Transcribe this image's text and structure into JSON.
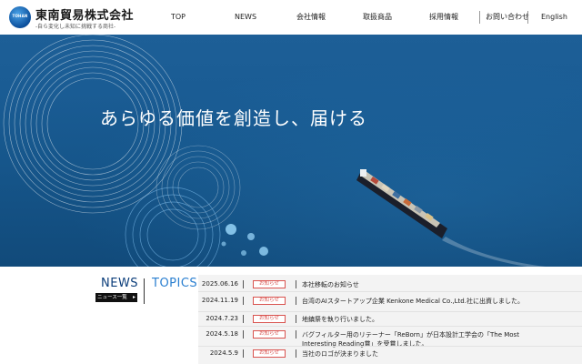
{
  "header": {
    "logo_text": "TOHAN",
    "company_name": "東南貿易株式会社",
    "tagline": "-自ら変化し未知に挑戦する商社-"
  },
  "nav": {
    "items": [
      "TOP",
      "NEWS",
      "会社情報",
      "取扱商品",
      "採用情報"
    ],
    "contact": "お問い合わせ",
    "language": "English"
  },
  "hero": {
    "headline": "あらゆる価値を創造し、届ける"
  },
  "news_section": {
    "news_title": "NEWS",
    "news_list_button": "ニュース一覧",
    "topics_title": "TOPICS",
    "items": [
      {
        "date": "2025.06.16",
        "badge": "お知らせ",
        "title": "本社移転のお知らせ"
      },
      {
        "date": "2024.11.19",
        "badge": "お知らせ",
        "title": "台湾のAIスタートアップ企業 Kenkone Medical Co.,Ltd.社に出資しました。"
      },
      {
        "date": "2024.7.23",
        "badge": "お知らせ",
        "title": "地鎮祭を執り行いました。"
      },
      {
        "date": "2024.5.18",
        "badge": "お知らせ",
        "title": "バグフィルター用のリテーナー「ReBorn」が日本設計工学会の「The Most Interesting Reading賞」を受賞しました。"
      },
      {
        "date": "2024.5.9",
        "badge": "お知らせ",
        "title": "当社のロゴが決まりました"
      }
    ]
  }
}
